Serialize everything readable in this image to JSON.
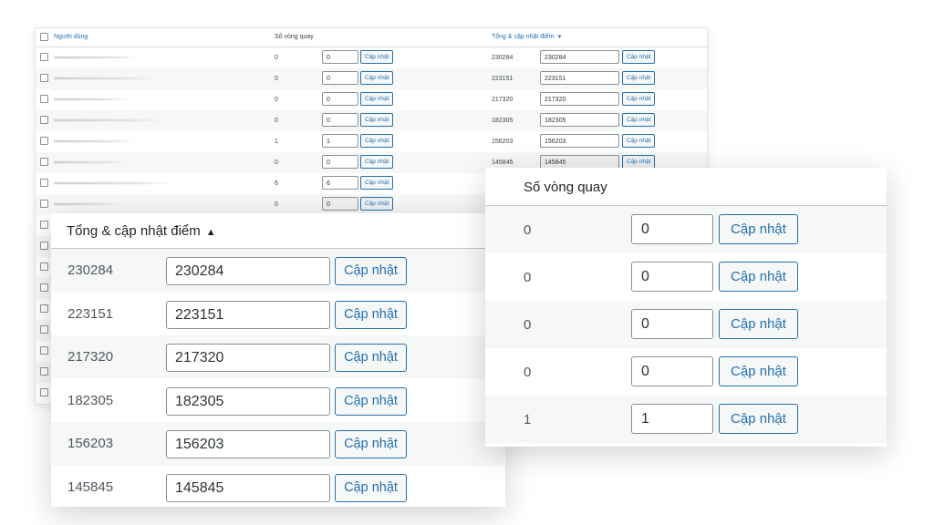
{
  "table": {
    "col_user": "Người dùng",
    "col_spins": "Số vòng quay",
    "col_points": "Tổng & cập nhật điểm",
    "sort_indicator_down": "▼",
    "update_label": "Cập nhật",
    "rows": [
      {
        "spins": "0",
        "spins_input": "0",
        "points": "230284",
        "points_input": "230284"
      },
      {
        "spins": "0",
        "spins_input": "0",
        "points": "223151",
        "points_input": "223151"
      },
      {
        "spins": "0",
        "spins_input": "0",
        "points": "217320",
        "points_input": "217320"
      },
      {
        "spins": "0",
        "spins_input": "0",
        "points": "182305",
        "points_input": "182305"
      },
      {
        "spins": "1",
        "spins_input": "1",
        "points": "156203",
        "points_input": "156203"
      },
      {
        "spins": "0",
        "spins_input": "0",
        "points": "145845",
        "points_input": "145845"
      },
      {
        "spins": "6",
        "spins_input": "6"
      },
      {
        "spins": "0",
        "spins_input": "0"
      }
    ]
  },
  "zoom_points": {
    "title": "Tổng & cập nhật điểm",
    "sort_indicator_up": "▲",
    "update_label": "Cập nhật",
    "rows": [
      {
        "value": "230284",
        "input": "230284"
      },
      {
        "value": "223151",
        "input": "223151"
      },
      {
        "value": "217320",
        "input": "217320"
      },
      {
        "value": "182305",
        "input": "182305"
      },
      {
        "value": "156203",
        "input": "156203"
      },
      {
        "value": "145845",
        "input": "145845"
      }
    ]
  },
  "zoom_spins": {
    "title": "Số vòng quay",
    "update_label": "Cập nhật",
    "rows": [
      {
        "value": "0",
        "input": "0"
      },
      {
        "value": "0",
        "input": "0"
      },
      {
        "value": "0",
        "input": "0"
      },
      {
        "value": "0",
        "input": "0"
      },
      {
        "value": "1",
        "input": "1"
      }
    ]
  },
  "colors": {
    "accent": "#2271b1",
    "row_alt": "#f6f7f7",
    "border": "#8c8f94"
  }
}
